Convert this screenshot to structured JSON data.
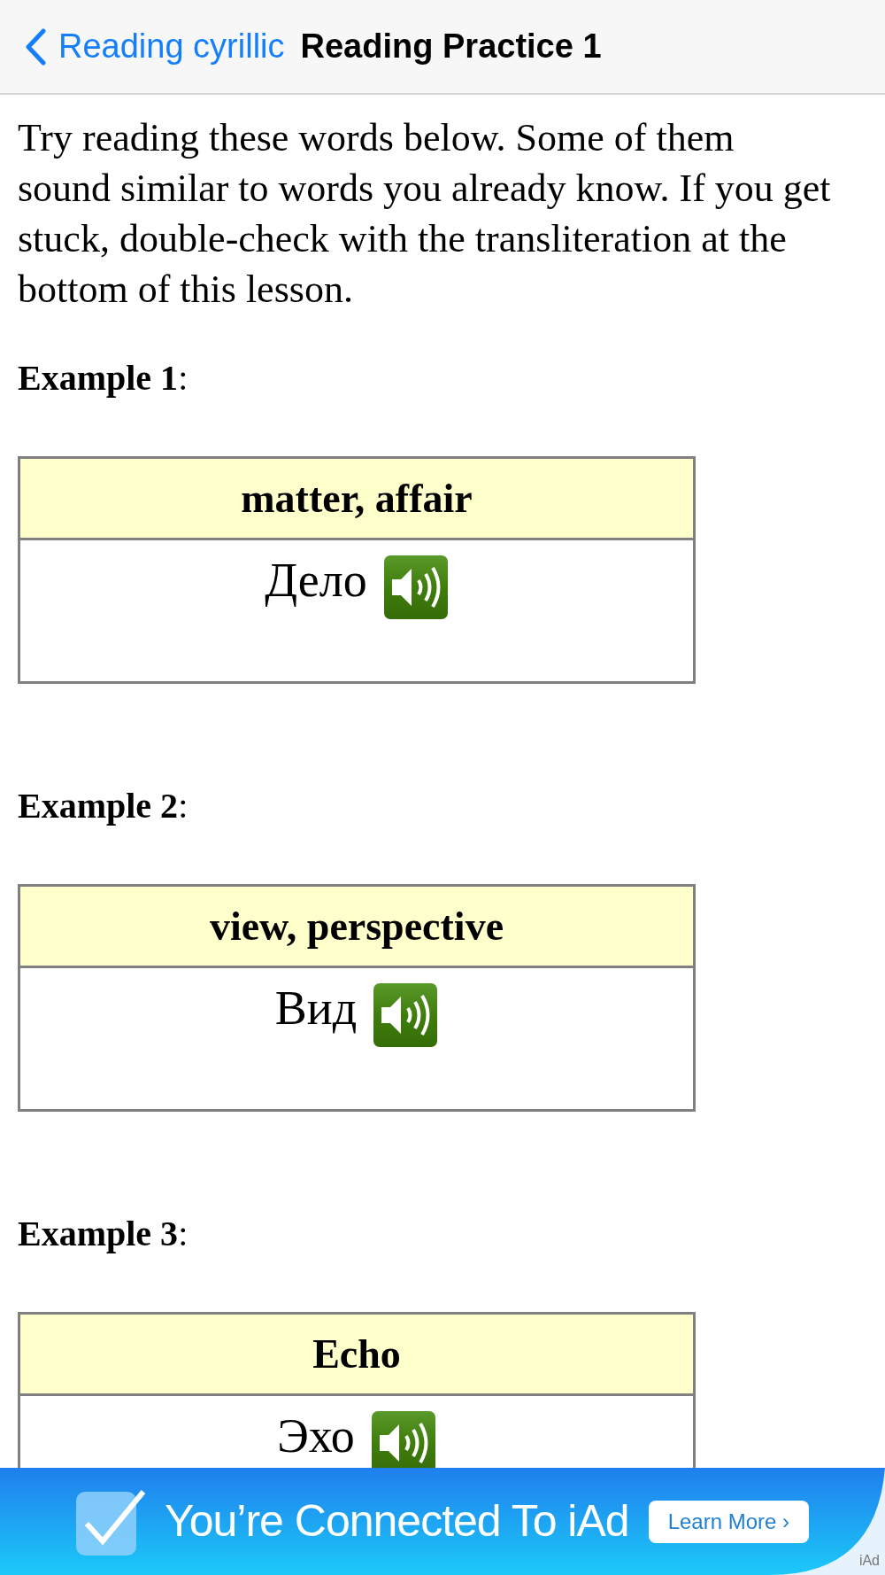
{
  "nav": {
    "back_label": "Reading cyrillic",
    "title": "Reading Practice 1"
  },
  "intro": "Try reading these words below. Some of them sound similar to words you already know. If you get stuck, double-check with the transliteration at the bottom of this lesson.",
  "examples": [
    {
      "label": "**Example 1**:",
      "meaning": "matter, affair",
      "word": "Дело"
    },
    {
      "label": "**Example 2**:",
      "meaning": "view, perspective",
      "word": "Вид"
    },
    {
      "label": "**Example 3**:",
      "meaning": "Echo",
      "word": "Эхо"
    }
  ],
  "ad": {
    "headline": "You’re Connected To iAd",
    "button": "Learn More ›",
    "tag": "iAd"
  }
}
